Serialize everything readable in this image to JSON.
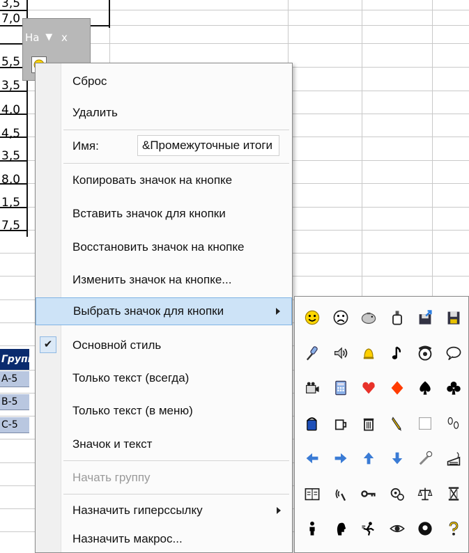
{
  "sheet": {
    "column_values": [
      "3,5",
      "7,0",
      "5,5",
      "3,5",
      "4,0",
      "4,5",
      "3,5",
      "8,0",
      "1,5",
      "7,5"
    ],
    "group_header": "Группа",
    "group_cells": [
      "A-5",
      "B-5",
      "C-5"
    ]
  },
  "toolbar": {
    "title": "На",
    "dropdown_glyph": "▼",
    "close_glyph": "x"
  },
  "menu": {
    "items": [
      {
        "label": "Сброс"
      },
      {
        "label": "Удалить"
      },
      {
        "label": "Имя:",
        "value": "&Промежуточные итоги"
      },
      {
        "label": "Копировать значок на кнопке"
      },
      {
        "label": "Вставить значок для кнопки"
      },
      {
        "label": "Восстановить значок на кнопке"
      },
      {
        "label": "Изменить значок на кнопке..."
      },
      {
        "label": "Выбрать значок для кнопки",
        "submenu": true,
        "highlighted": true
      },
      {
        "label": "Основной стиль",
        "checked": true
      },
      {
        "label": "Только текст (всегда)"
      },
      {
        "label": "Только текст (в меню)"
      },
      {
        "label": "Значок и текст"
      },
      {
        "label": "Начать группу",
        "disabled": true
      },
      {
        "label": "Назначить гиперссылку",
        "submenu": true
      },
      {
        "label": "Назначить макрос..."
      }
    ],
    "check_glyph": "✔"
  },
  "icon_grid": [
    [
      "smiley-icon",
      "frown-icon",
      "piggy-bank-icon",
      "bottle-icon",
      "disk-arrow-icon",
      "disk-icon"
    ],
    [
      "microphone-icon",
      "speaker-icon",
      "bell-icon",
      "music-note-icon",
      "telephone-icon",
      "speech-bubble-icon"
    ],
    [
      "video-camera-icon",
      "calculator-icon",
      "heart-icon",
      "diamond-icon",
      "spade-icon",
      "club-icon"
    ],
    [
      "paint-bucket-icon",
      "cup-icon",
      "trash-can-icon",
      "pencil-icon",
      "blank-icon",
      "footprints-icon"
    ],
    [
      "arrow-left-icon",
      "arrow-right-icon",
      "arrow-up-icon",
      "arrow-down-icon",
      "magic-wand-icon",
      "keyboard-icon"
    ],
    [
      "book-icon",
      "radio-waves-icon",
      "key-icon",
      "gears-icon",
      "scales-icon",
      "hourglass-icon"
    ],
    [
      "person-icon",
      "head-icon",
      "runner-icon",
      "eye-icon",
      "eight-ball-icon",
      "question-icon"
    ]
  ],
  "colors": {
    "highlight": "#cde3f7",
    "group_header": "#0a2b6e",
    "group_cell": "#b9c7e0",
    "heart": "#e8322a",
    "diamond": "#ff3b00",
    "arrow": "#3a7bd5"
  }
}
